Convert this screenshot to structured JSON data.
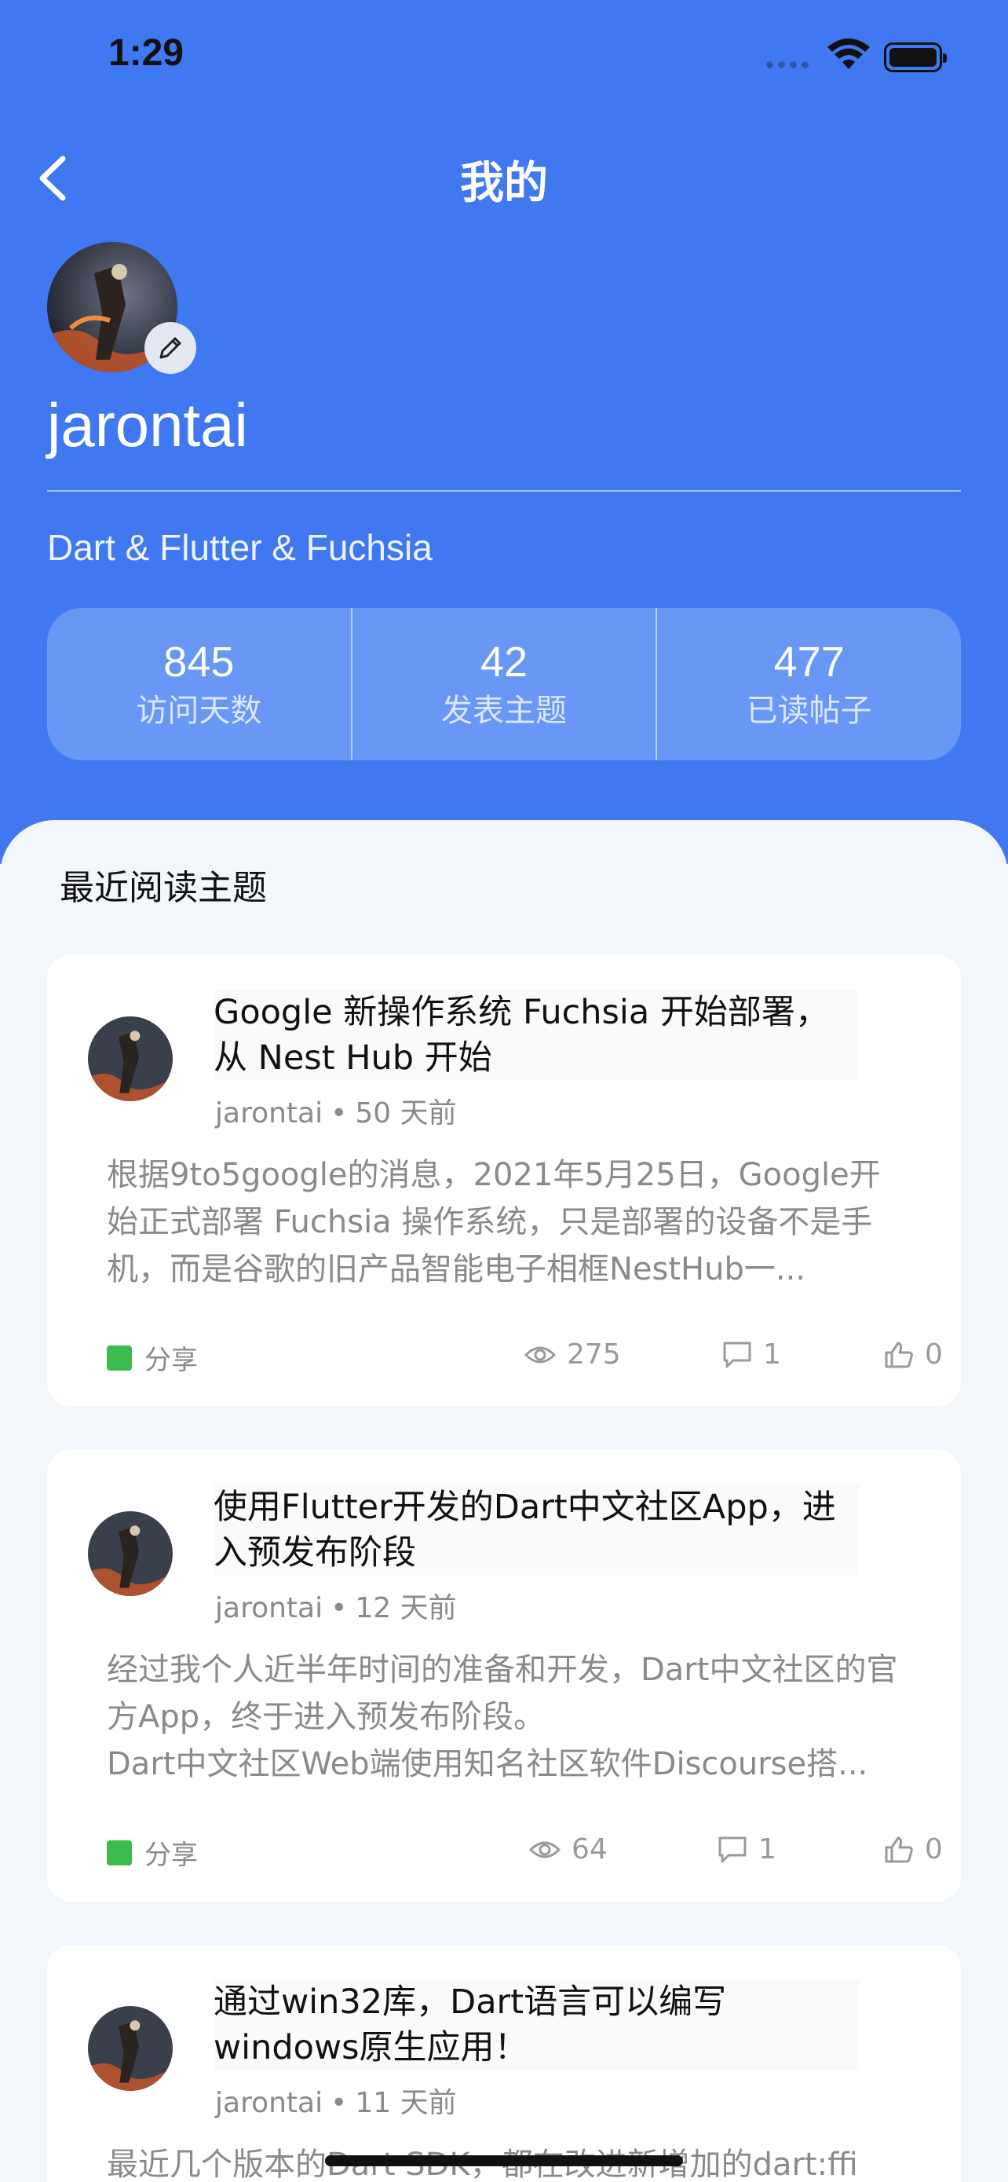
{
  "status_bar": {
    "time": "1:29"
  },
  "header": {
    "title": "我的"
  },
  "profile": {
    "username": "jarontai",
    "bio": "Dart & Flutter & Fuchsia",
    "stats": [
      {
        "value": "845",
        "label": "访问天数"
      },
      {
        "value": "42",
        "label": "发表主题"
      },
      {
        "value": "477",
        "label": "已读帖子"
      }
    ]
  },
  "section": {
    "title": "最近阅读主题"
  },
  "posts": [
    {
      "title": "Google 新操作系统 Fuchsia 开始部署，从 Nest Hub 开始",
      "author": "jarontai",
      "time": "50 天前",
      "excerpt": "根据9to5google的消息，2021年5月25日，Google开始正式部署 Fuchsia  操作系统，只是部署的设备不是手机，而是谷歌的旧产品智能电子相框NestHub一...",
      "tag": "分享",
      "views": "275",
      "replies": "1",
      "likes": "0"
    },
    {
      "title": "使用Flutter开发的Dart中文社区App，进入预发布阶段",
      "author": "jarontai",
      "time": "12 天前",
      "excerpt": "经过我个人近半年时间的准备和开发，Dart中文社区的官方App，终于进入预发布阶段。\nDart中文社区Web端使用知名社区软件Discourse搭...",
      "tag": "分享",
      "views": "64",
      "replies": "1",
      "likes": "0"
    },
    {
      "title": "通过win32库，Dart语言可以编写windows原生应用！",
      "author": "jarontai",
      "time": "11 天前",
      "excerpt": "最近几个版本的Dart SDK，都在改进新增加的dart:ffi",
      "tag": "",
      "views": "",
      "replies": "",
      "likes": ""
    }
  ],
  "colors": {
    "header_bg": "#3f78f0",
    "tag_green": "#3cbb4f"
  }
}
